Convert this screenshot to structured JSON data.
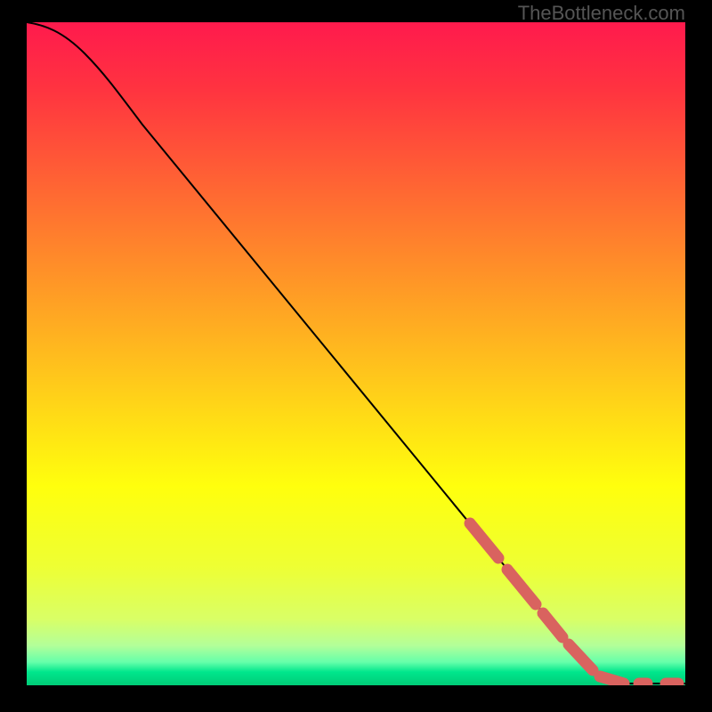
{
  "watermark": "TheBottleneck.com",
  "chart_data": {
    "type": "line",
    "title": "",
    "xlabel": "",
    "ylabel": "",
    "xlim": [
      0,
      100
    ],
    "ylim": [
      0,
      100
    ],
    "curve": {
      "description": "Bottleneck curve descending from top-left to bottom-right flat segment",
      "x": [
        0,
        4,
        8,
        12,
        20,
        30,
        40,
        50,
        60,
        70,
        80,
        84,
        88,
        92,
        96,
        100
      ],
      "y": [
        100,
        99,
        97,
        94,
        86,
        74,
        62,
        50,
        38,
        26,
        14,
        8,
        3,
        0,
        0,
        0
      ]
    },
    "highlighted_segments": [
      {
        "x_range": [
          68,
          72
        ],
        "type": "thick-coral"
      },
      {
        "x_range": [
          73,
          77
        ],
        "type": "thick-coral"
      },
      {
        "x_range": [
          78,
          81
        ],
        "type": "thick-coral"
      },
      {
        "x_range": [
          82,
          86
        ],
        "type": "thick-coral"
      },
      {
        "x_range": [
          87,
          91
        ],
        "type": "thick-coral"
      },
      {
        "x_range": [
          93,
          94
        ],
        "type": "thick-coral"
      },
      {
        "x_range": [
          97,
          99
        ],
        "type": "thick-coral"
      }
    ],
    "background_gradient": {
      "description": "Vertical rainbow gradient red to green indicating bottleneck severity",
      "stops": [
        {
          "pos": 0.0,
          "color": "#ff1a4d"
        },
        {
          "pos": 0.1,
          "color": "#ff3340"
        },
        {
          "pos": 0.25,
          "color": "#ff6633"
        },
        {
          "pos": 0.4,
          "color": "#ff9926"
        },
        {
          "pos": 0.55,
          "color": "#ffcc1a"
        },
        {
          "pos": 0.7,
          "color": "#ffff0d"
        },
        {
          "pos": 0.82,
          "color": "#eeff33"
        },
        {
          "pos": 0.9,
          "color": "#d9ff66"
        },
        {
          "pos": 0.94,
          "color": "#b3ff99"
        },
        {
          "pos": 0.965,
          "color": "#66ffaa"
        },
        {
          "pos": 0.98,
          "color": "#00e68c"
        },
        {
          "pos": 1.0,
          "color": "#00cc77"
        }
      ]
    },
    "colors": {
      "curve_line": "#000000",
      "highlight": "#d9635f",
      "background_outside": "#000000"
    }
  }
}
